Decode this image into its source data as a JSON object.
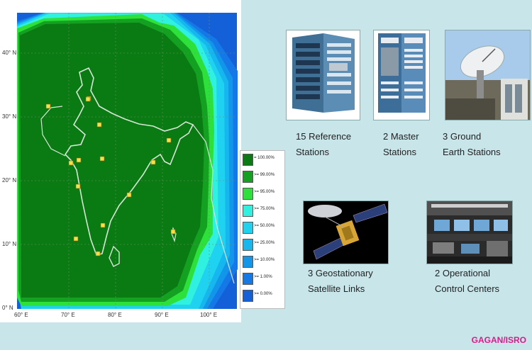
{
  "map": {
    "lat_ticks": [
      "40° N",
      "30° N",
      "20° N",
      "10° N",
      "0° N"
    ],
    "lon_ticks": [
      "60° E",
      "70° E",
      "80° E",
      "90° E",
      "100° E"
    ],
    "station_markers": 15
  },
  "legend": {
    "items": [
      {
        "label": "= 100.00%",
        "color": "#0a7a12"
      },
      {
        "label": ">= 99.00%",
        "color": "#14a020"
      },
      {
        "label": ">= 95.00%",
        "color": "#2ee03a"
      },
      {
        "label": ">= 75.00%",
        "color": "#30f0e0"
      },
      {
        "label": ">= 50.00%",
        "color": "#1fd2f0"
      },
      {
        "label": ">= 25.00%",
        "color": "#16b6ee"
      },
      {
        "label": ">= 10.00%",
        "color": "#1296ea"
      },
      {
        "label": ">= 1.00%",
        "color": "#1478e6"
      },
      {
        "label": ">= 0.00%",
        "color": "#1460d8"
      }
    ]
  },
  "components": [
    {
      "line1": "15 Reference",
      "line2": "Stations",
      "icon": "server-rack-icon"
    },
    {
      "line1": "2 Master",
      "line2": "Stations",
      "icon": "master-rack-icon"
    },
    {
      "line1": "3 Ground",
      "line2": "Earth Stations",
      "icon": "satellite-dish-icon"
    },
    {
      "line1": "3 Geostationary",
      "line2": "Satellite Links",
      "icon": "satellite-icon"
    },
    {
      "line1": "2 Operational",
      "line2": "Control Centers",
      "icon": "control-room-icon"
    }
  ],
  "credit": "GAGAN/ISRO"
}
